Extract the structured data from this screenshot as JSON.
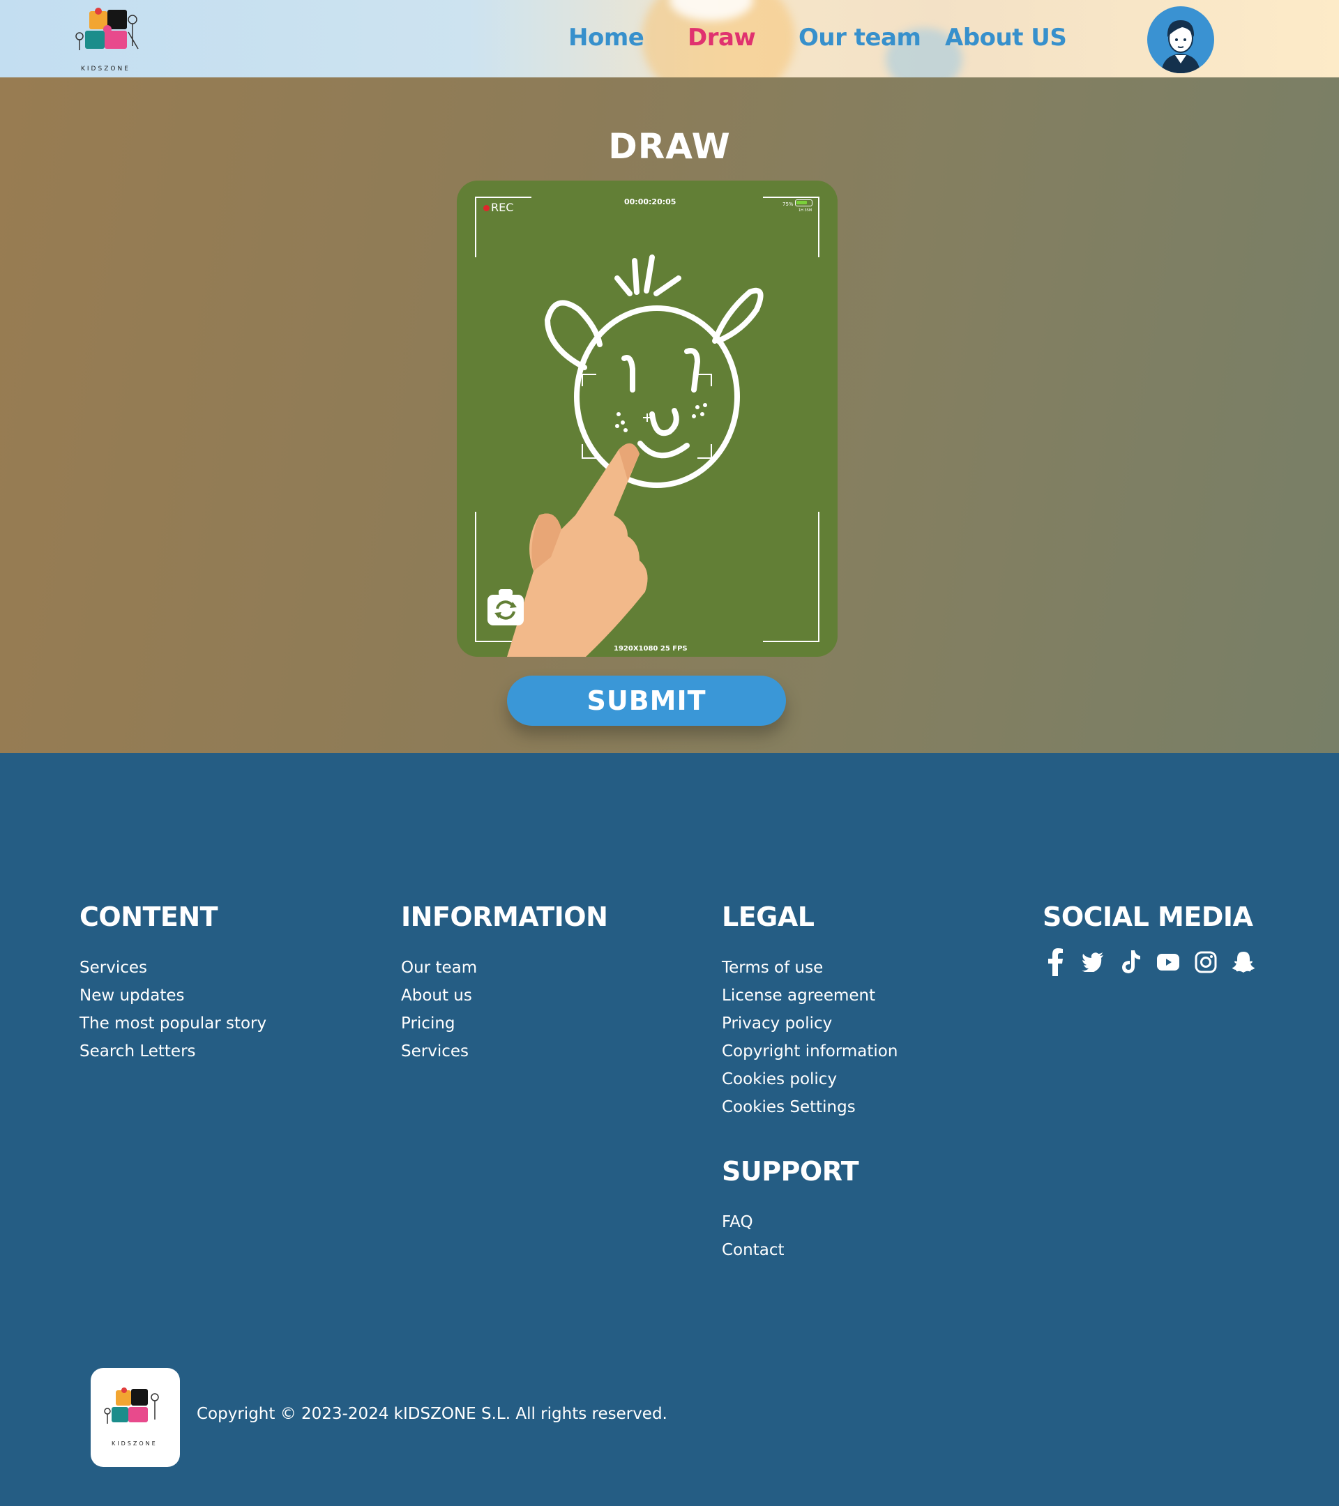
{
  "header": {
    "logo_text": "KIDSZONE",
    "nav": [
      {
        "label": "Home",
        "active": false
      },
      {
        "label": "Draw",
        "active": true
      },
      {
        "label": "Our team",
        "active": false
      },
      {
        "label": "About US",
        "active": false
      }
    ]
  },
  "draw": {
    "title": "DRAW",
    "camera": {
      "rec_label": "REC",
      "timecode": "00:00:20:05",
      "battery_percent": "75%",
      "battery_level": 0.75,
      "battery_sub": "1H 35M",
      "resolution": "1920X1080 25 FPS"
    },
    "submit_label": "SUBMIT"
  },
  "footer": {
    "content": {
      "title": "CONTENT",
      "links": [
        "Services",
        "New updates",
        "The most popular story",
        "Search Letters"
      ]
    },
    "information": {
      "title": "INFORMATION",
      "links": [
        "Our team",
        "About us",
        "Pricing",
        "Services"
      ]
    },
    "legal": {
      "title": "LEGAL",
      "links": [
        "Terms of use",
        "License agreement",
        "Privacy policy",
        "Copyright information",
        "Cookies policy",
        "Cookies Settings"
      ]
    },
    "support": {
      "title": "SUPPORT",
      "links": [
        "FAQ",
        "Contact"
      ]
    },
    "social": {
      "title": "SOCIAL MEDIA",
      "icons": [
        "facebook-icon",
        "twitter-icon",
        "tiktok-icon",
        "youtube-icon",
        "instagram-icon",
        "snapchat-icon"
      ]
    },
    "copyright": "Copyright © 2023-2024 kIDSZONE S.L. All rights reserved."
  },
  "colors": {
    "nav_link": "#3790cc",
    "nav_active": "#e0326f",
    "footer_bg": "#255d84",
    "camera_bg": "#627f36",
    "submit_bg": "#3a97d7"
  }
}
